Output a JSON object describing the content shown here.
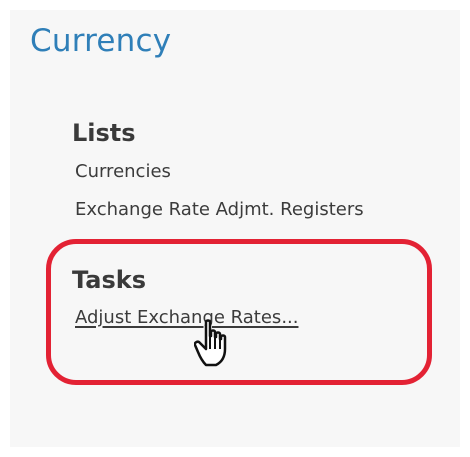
{
  "section": {
    "title": "Currency"
  },
  "lists": {
    "heading": "Lists",
    "items": [
      {
        "label": "Currencies"
      },
      {
        "label": "Exchange Rate Adjmt. Registers"
      }
    ]
  },
  "tasks": {
    "heading": "Tasks",
    "items": [
      {
        "label": "Adjust Exchange Rates..."
      }
    ]
  },
  "cursor": {
    "icon": "hand-pointer-icon"
  },
  "colors": {
    "title": "#2f7fb8",
    "highlight": "#e32234",
    "text": "#3a3a3a",
    "panel": "#f7f7f7"
  }
}
